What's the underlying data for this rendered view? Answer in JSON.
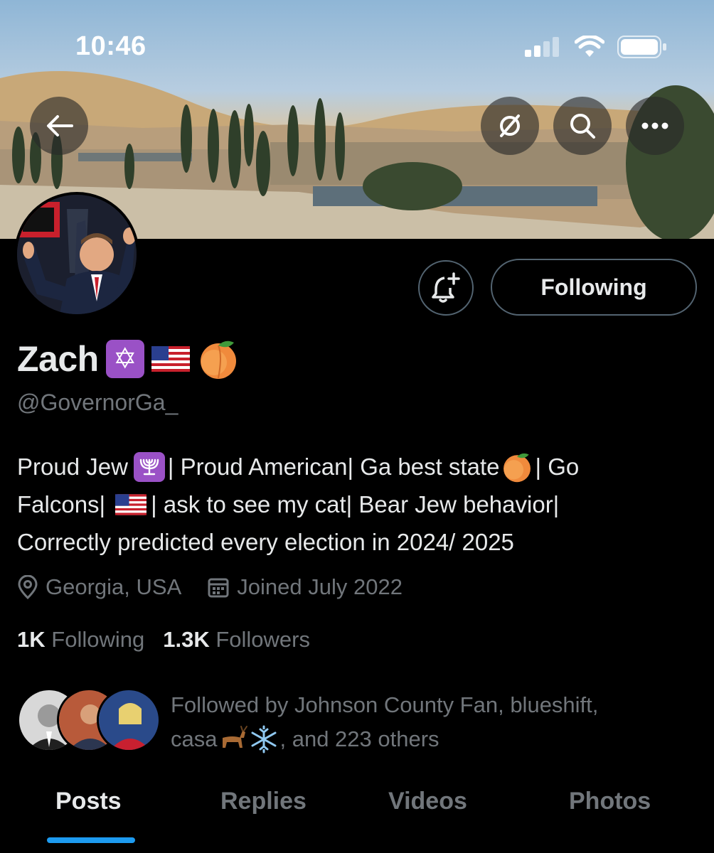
{
  "status_bar": {
    "time": "10:46"
  },
  "profile": {
    "name": "Zach",
    "name_emojis": [
      "star-of-david",
      "us-flag",
      "peach"
    ],
    "handle": "@GovernorGa_",
    "bio": {
      "line1_a": "Proud Jew ",
      "line1_b": "| Proud American| Ga best state",
      "line1_c": "| Go",
      "line2_a": "Falcons| ",
      "line2_b": "| ask to see my cat| Bear Jew behavior|",
      "line3": "Correctly predicted every election in 2024/ 2025"
    },
    "location": "Georgia, USA",
    "joined": "Joined July 2022",
    "following_count": "1K",
    "following_label": "Following",
    "followers_count": "1.3K",
    "followers_label": "Followers",
    "followed_by_line1": "Followed by Johnson County Fan, blueshift,",
    "followed_by_line2_a": "casa ",
    "followed_by_line2_b": ", and 223 others"
  },
  "actions": {
    "follow_button_label": "Following"
  },
  "tabs": [
    {
      "label": "Posts",
      "active": true
    },
    {
      "label": "Replies",
      "active": false
    },
    {
      "label": "Videos",
      "active": false
    },
    {
      "label": "Photos",
      "active": false
    }
  ],
  "colors": {
    "accent": "#1d9bf0",
    "secondary_text": "#71767b",
    "primary_text": "#e7e9ea",
    "background": "#000000"
  }
}
